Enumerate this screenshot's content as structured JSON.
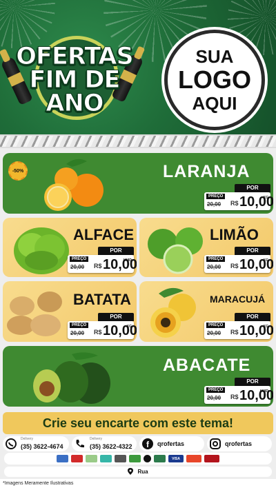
{
  "header": {
    "title_lines": [
      "OFERTAS",
      "FIM DE",
      "ANO"
    ],
    "logo_lines": [
      "SUA",
      "LOGO",
      "AQUI"
    ]
  },
  "products": [
    {
      "name": "LARANJA",
      "discount": "-50%",
      "preco_label": "PREÇO",
      "por_label": "POR",
      "old_price": "20,00",
      "currency": "R$",
      "price": "10,00",
      "unit": "KG"
    },
    {
      "name": "ALFACE",
      "preco_label": "PREÇO",
      "por_label": "POR",
      "old_price": "20,00",
      "currency": "R$",
      "price": "10,00",
      "unit": "UNID"
    },
    {
      "name": "LIMÃO",
      "preco_label": "PREÇO",
      "por_label": "POR",
      "old_price": "20,00",
      "currency": "R$",
      "price": "10,00",
      "unit": "KG"
    },
    {
      "name": "BATATA",
      "preco_label": "PREÇO",
      "por_label": "POR",
      "old_price": "20,00",
      "currency": "R$",
      "price": "10,00",
      "unit": "KG"
    },
    {
      "name": "MARACUJÁ",
      "preco_label": "PREÇO",
      "por_label": "POR",
      "old_price": "20,00",
      "currency": "R$",
      "price": "10,00",
      "unit": "KG"
    },
    {
      "name": "ABACATE",
      "preco_label": "PREÇO",
      "por_label": "POR",
      "old_price": "20,00",
      "currency": "R$",
      "price": "10,00",
      "unit": "UNID"
    }
  ],
  "cta": {
    "label": "Crie seu encarte com este tema!"
  },
  "contacts": {
    "whatsapp": {
      "small": "Delivery",
      "text": "(35) 3622-4674"
    },
    "phone": {
      "small": "Delivery",
      "text": "(35) 3622-4322"
    },
    "facebook": {
      "text": "qrofertas"
    },
    "instagram": {
      "text": "qrofertas"
    }
  },
  "payments": {
    "icons": [
      "card-icon",
      "card-red-icon",
      "cash-icon",
      "pix-icon",
      "voucher-icon",
      "alelo-icon",
      "elo-icon",
      "diners-icon",
      "visa-icon",
      "mastercard-icon",
      "hipercard-icon"
    ],
    "visa_label": "VISA"
  },
  "address": {
    "text": "Rua"
  },
  "disclaimer": "*Imagens Meramente Ilustrativas",
  "colors": {
    "green": "#3f8a31",
    "yellow": "#f3c96a",
    "cta": "#f0c85c",
    "dark_green": "#1d6b3a"
  }
}
